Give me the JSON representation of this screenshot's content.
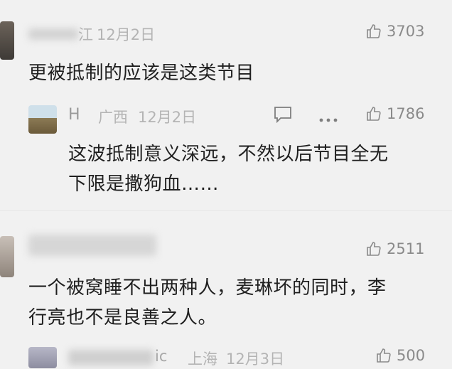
{
  "comments": [
    {
      "username": "江",
      "timestamp": "12月2日",
      "likes": "3703",
      "text": "更被抵制的应该是这类节目"
    },
    {
      "username": "H",
      "location": "广西",
      "timestamp": "12月2日",
      "likes": "1786",
      "text_line1": "这波抵制意义深远，不然以后节目全无",
      "text_line2": "下限是撒狗血……"
    },
    {
      "likes": "2511",
      "text_line1": "一个被窝睡不出两种人，麦琳坏的同时，李",
      "text_line2": "行亮也不是良善之人。"
    },
    {
      "username": "ic",
      "location": "上海",
      "timestamp": "12月3日",
      "likes": "500"
    }
  ],
  "colors": {
    "background": "#f1f1f1",
    "meta_text": "#b4b4b4",
    "body_text": "#1f1f1f"
  }
}
